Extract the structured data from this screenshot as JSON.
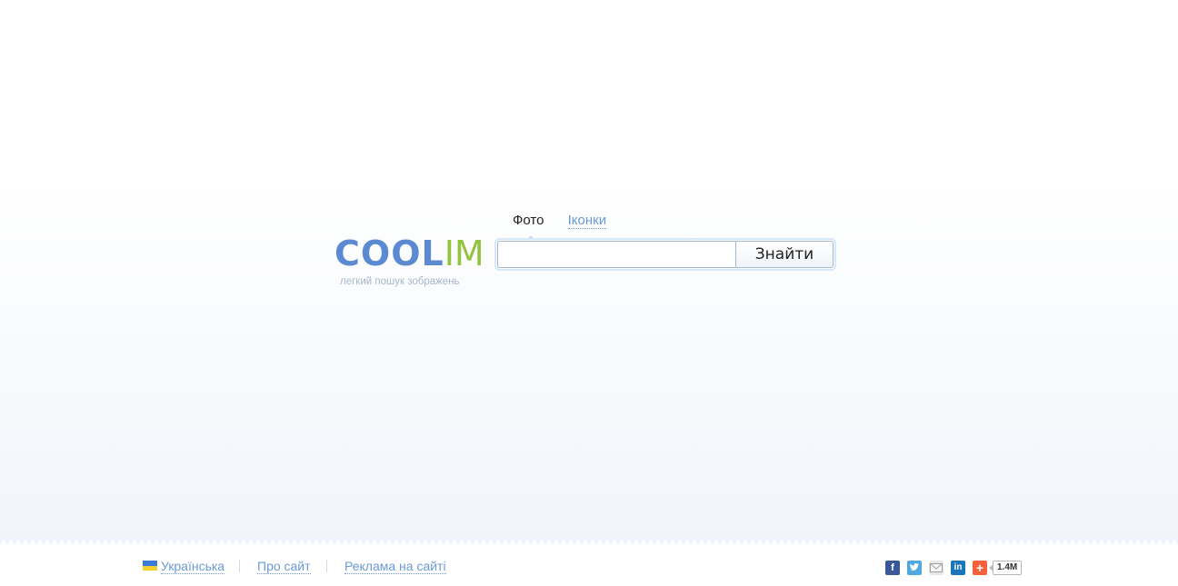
{
  "logo": {
    "part1": "COOL",
    "part2": "IM",
    "tagline": "легкий пошук зображень",
    "color_cool": "#5b89d2",
    "color_im": "#94c33f"
  },
  "tabs": [
    {
      "label": "Фото",
      "active": true
    },
    {
      "label": "Іконки",
      "active": false
    }
  ],
  "search": {
    "value": "",
    "placeholder": "",
    "button_label": "Знайти"
  },
  "footer": {
    "language": "Українська",
    "links": [
      "Про сайт",
      "Реклама на сайті"
    ],
    "social": {
      "icons": [
        "facebook-icon",
        "twitter-icon",
        "mail-icon",
        "linkedin-icon",
        "addthis-icon"
      ],
      "share_count": "1.4M"
    }
  },
  "colors": {
    "link": "#6a9ad6",
    "background_bottom": "#f1f5fb"
  }
}
